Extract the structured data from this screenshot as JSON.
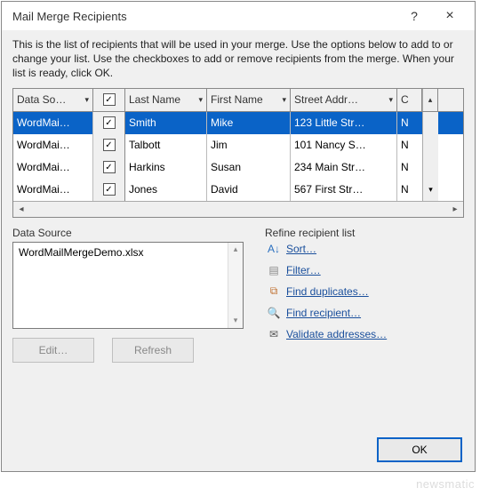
{
  "titlebar": {
    "title": "Mail Merge Recipients",
    "help": "?",
    "close": "×"
  },
  "intro": "This is the list of recipients that will be used in your merge.  Use the options below to add to or change your list.  Use the checkboxes to add or remove recipients from the merge.  When your list is ready, click OK.",
  "columns": {
    "ds": "Data So…",
    "last": "Last Name",
    "first": "First Name",
    "street": "Street Addr…",
    "c": "C"
  },
  "rows": [
    {
      "ds": "WordMai…",
      "checked": true,
      "last": "Smith",
      "first": "Mike",
      "street": "123 Little Str…",
      "c": "N"
    },
    {
      "ds": "WordMai…",
      "checked": true,
      "last": "Talbott",
      "first": "Jim",
      "street": "101 Nancy S…",
      "c": "N"
    },
    {
      "ds": "WordMai…",
      "checked": true,
      "last": "Harkins",
      "first": "Susan",
      "street": "234 Main Str…",
      "c": "N"
    },
    {
      "ds": "WordMai…",
      "checked": true,
      "last": "Jones",
      "first": "David",
      "street": "567 First Str…",
      "c": "N"
    }
  ],
  "dataSource": {
    "label": "Data Source",
    "item": "WordMailMergeDemo.xlsx",
    "edit": "Edit…",
    "refresh": "Refresh"
  },
  "refine": {
    "label": "Refine recipient list",
    "sort": "Sort…",
    "filter": "Filter…",
    "dup": "Find duplicates…",
    "find": "Find recipient…",
    "validate": "Validate addresses…"
  },
  "ok": "OK",
  "watermark": "newsmatic"
}
